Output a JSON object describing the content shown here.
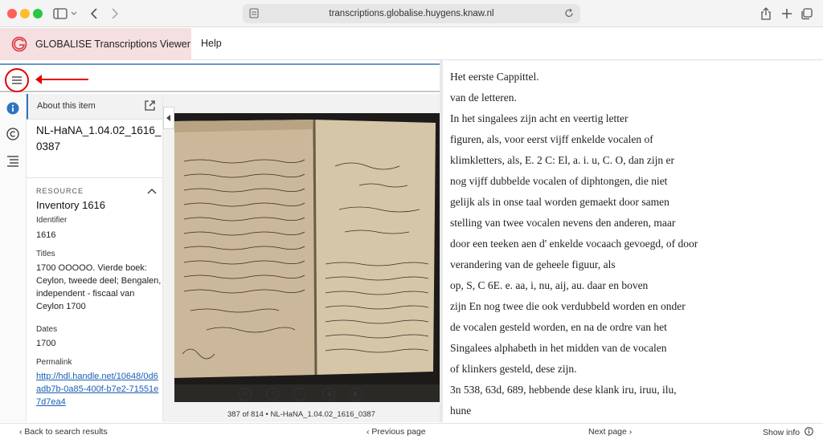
{
  "browser": {
    "url": "transcriptions.globalise.huygens.knaw.nl"
  },
  "header": {
    "app_title": "GLOBALISE Transcriptions Viewer",
    "help_label": "Help",
    "accent_color": "#f5dfe1"
  },
  "info_panel": {
    "title": "About this item",
    "item_id": "NL-HaNA_1.04.02_1616_0387",
    "section_label": "RESOURCE",
    "resource_title": "Inventory 1616",
    "fields": [
      {
        "label": "Identifier",
        "value": "1616"
      },
      {
        "label": "Titles",
        "value": "1700 OOOOO. Vierde boek: Ceylon, tweede deel; Bengalen, independent - fiscaal van Ceylon 1700"
      },
      {
        "label": "Dates",
        "value": "1700"
      },
      {
        "label": "Permalink",
        "value": "http://hdl.handle.net/10648/0d6adb7b-0a85-400f-b7e2-71551e7d7ea4"
      }
    ]
  },
  "viewer": {
    "caption": "387 of 814 • NL-HaNA_1.04.02_1616_0387"
  },
  "transcription": {
    "lines": [
      "Het eerste Cappittel.",
      "van de letteren.",
      "In het singalees zijn acht en veertig letter",
      "figuren, als, voor eerst vijff enkelde vocalen of",
      "klimkletters, als, E. 2 C: El, a. i. u, C. O, dan zijn er",
      "nog vijff dubbelde vocalen of diphtongen, die niet",
      "gelijk als in onse taal worden gemaekt door samen",
      "stelling van twee vocalen nevens den anderen, maar",
      "door een teeken aen d' enkelde vocaach gevoegd, of door",
      "verandering van de geheele figuur, als",
      "op, S, C 6E. e. aa, i, nu, aij, au. daar en boven",
      "zijn En nog twee die ook verdubbeld worden en onder",
      "de vocalen gesteld worden, en na de ordre van het",
      "Singalees alphabeth in het midden van de vocalen",
      "of klinkers gesteld, dese zijn.",
      "3n 538, 63d, 689, hebbende dese klank iru, iruu, ilu,",
      "hune"
    ]
  },
  "footer": {
    "back_label": "Back to search results",
    "prev_label": "Previous page",
    "next_label": "Next page",
    "show_info_label": "Show info"
  }
}
